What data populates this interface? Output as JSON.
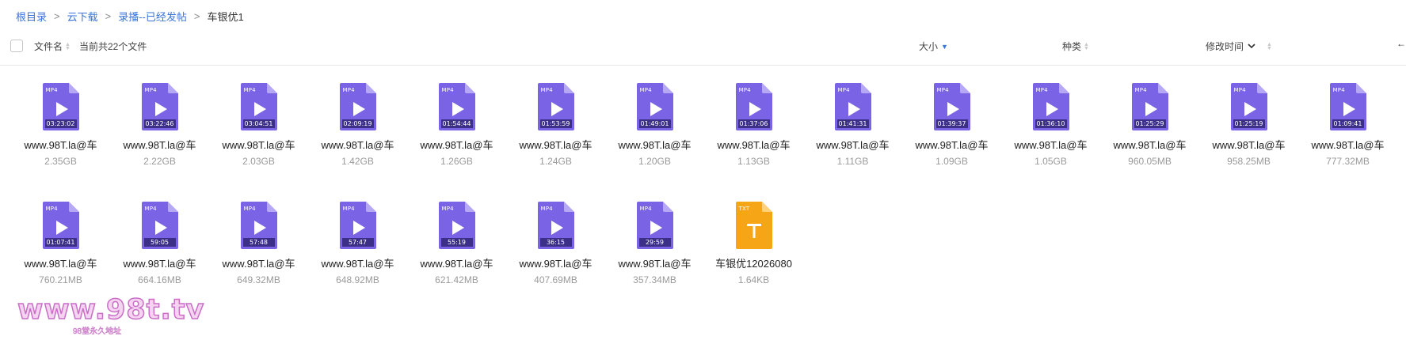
{
  "breadcrumb": [
    {
      "label": "根目录"
    },
    {
      "label": "云下载"
    },
    {
      "label": "录播--已经发帖"
    },
    {
      "label": "车银优1"
    }
  ],
  "header": {
    "name_col": "文件名",
    "count_text": "当前共22个文件",
    "size_col": "大小",
    "type_col": "种类",
    "modified_col": "修改时间",
    "sort_active": "size-desc"
  },
  "icons": {
    "video_color": "#7b63e6",
    "video_fold": "#b6a8f5",
    "txt_color": "#f6a516",
    "txt_fold": "#ffd27a"
  },
  "files": [
    {
      "name": "www.98T.la@车",
      "size": "2.35GB",
      "type": "MP4",
      "duration": "03:23:02"
    },
    {
      "name": "www.98T.la@车",
      "size": "2.22GB",
      "type": "MP4",
      "duration": "03:22:46"
    },
    {
      "name": "www.98T.la@车",
      "size": "2.03GB",
      "type": "MP4",
      "duration": "03:04:51"
    },
    {
      "name": "www.98T.la@车",
      "size": "1.42GB",
      "type": "MP4",
      "duration": "02:09:19"
    },
    {
      "name": "www.98T.la@车",
      "size": "1.26GB",
      "type": "MP4",
      "duration": "01:54:44"
    },
    {
      "name": "www.98T.la@车",
      "size": "1.24GB",
      "type": "MP4",
      "duration": "01:53:59"
    },
    {
      "name": "www.98T.la@车",
      "size": "1.20GB",
      "type": "MP4",
      "duration": "01:49:01"
    },
    {
      "name": "www.98T.la@车",
      "size": "1.13GB",
      "type": "MP4",
      "duration": "01:37:06"
    },
    {
      "name": "www.98T.la@车",
      "size": "1.11GB",
      "type": "MP4",
      "duration": "01:41:31"
    },
    {
      "name": "www.98T.la@车",
      "size": "1.09GB",
      "type": "MP4",
      "duration": "01:39:37"
    },
    {
      "name": "www.98T.la@车",
      "size": "1.05GB",
      "type": "MP4",
      "duration": "01:36:10"
    },
    {
      "name": "www.98T.la@车",
      "size": "960.05MB",
      "type": "MP4",
      "duration": "01:25:29"
    },
    {
      "name": "www.98T.la@车",
      "size": "958.25MB",
      "type": "MP4",
      "duration": "01:25:19"
    },
    {
      "name": "www.98T.la@车",
      "size": "777.32MB",
      "type": "MP4",
      "duration": "01:09:41"
    },
    {
      "name": "www.98T.la@车",
      "size": "760.21MB",
      "type": "MP4",
      "duration": "01:07:41"
    },
    {
      "name": "www.98T.la@车",
      "size": "664.16MB",
      "type": "MP4",
      "duration": "59:05"
    },
    {
      "name": "www.98T.la@车",
      "size": "649.32MB",
      "type": "MP4",
      "duration": "57:48"
    },
    {
      "name": "www.98T.la@车",
      "size": "648.92MB",
      "type": "MP4",
      "duration": "57:47"
    },
    {
      "name": "www.98T.la@车",
      "size": "621.42MB",
      "type": "MP4",
      "duration": "55:19"
    },
    {
      "name": "www.98T.la@车",
      "size": "407.69MB",
      "type": "MP4",
      "duration": "36:15"
    },
    {
      "name": "www.98T.la@车",
      "size": "357.34MB",
      "type": "MP4",
      "duration": "29:59"
    },
    {
      "name": "车银优12026080",
      "size": "1.64KB",
      "type": "TXT",
      "duration": ""
    }
  ],
  "watermark": {
    "main": "www.98t.tv",
    "sub": "98堂永久地址"
  }
}
